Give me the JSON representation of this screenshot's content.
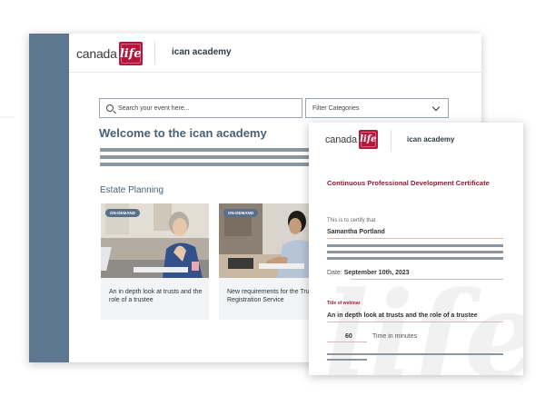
{
  "academy": {
    "logo_word": "canada",
    "logo_mark": "life",
    "title": "ican academy",
    "search_placeholder": "Search your event here...",
    "filter_label": "Filter Categories",
    "welcome": "Welcome to the ican academy",
    "section_title": "Estate Planning",
    "cards": [
      {
        "badge": "ON-DEMAND",
        "title": "An in depth look at trusts and the role of a trustee"
      },
      {
        "badge": "ON-DEMAND",
        "title": "New requirements for the Trust Registration Service"
      }
    ]
  },
  "certificate": {
    "logo_word": "canada",
    "logo_mark": "life",
    "brand": "ican academy",
    "title": "Continuous Professional Development Certificate",
    "certify_text": "This is to certify that",
    "recipient": "Samantha Portland",
    "date_label": "Date:",
    "date_value": "September 10th, 2023",
    "webinar_label": "Title of webinar",
    "webinar_title": "An in depth look at trusts and the role of a trustee",
    "time_value": "60",
    "time_label": "Time in minutes"
  },
  "colors": {
    "rail": "#5e7790",
    "brand_red": "#b4163c",
    "cert_title": "#8e1b2f",
    "heading": "#4a6075",
    "badge": "#58708a"
  }
}
